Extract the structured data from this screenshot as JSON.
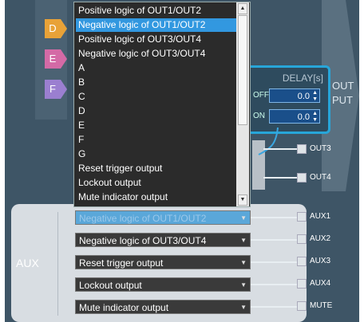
{
  "colors": {
    "selected": "#3298e0",
    "accent": "#27a6d9"
  },
  "tabs": [
    {
      "label": "D",
      "color": "#e8a238"
    },
    {
      "label": "E",
      "color": "#d46aa6"
    },
    {
      "label": "F",
      "color": "#9b7fd0"
    }
  ],
  "dropdown": {
    "options": [
      "Positive logic of OUT1/OUT2",
      "Negative logic of OUT1/OUT2",
      "Positive logic of OUT3/OUT4",
      "Negative logic of OUT3/OUT4",
      "A",
      "B",
      "C",
      "D",
      "E",
      "F",
      "G",
      "Reset trigger output",
      "Lockout output",
      "Mute indicator output"
    ],
    "selected_index": 1
  },
  "delay": {
    "title": "DELAY[s]",
    "off_label": "OFF",
    "on_label": "ON",
    "off_value": "0.0",
    "on_value": "0.0"
  },
  "output_label": [
    "OUT",
    "PUT"
  ],
  "terminals": {
    "out3": "OUT3",
    "out4": "OUT4",
    "aux1": "AUX1",
    "aux2": "AUX2",
    "aux3": "AUX3",
    "aux4": "AUX4",
    "mute": "MUTE"
  },
  "aux": {
    "label": "AUX",
    "selects": [
      "Negative logic of OUT1/OUT2",
      "Negative logic of OUT3/OUT4",
      "Reset trigger output",
      "Lockout output",
      "Mute indicator output"
    ]
  }
}
